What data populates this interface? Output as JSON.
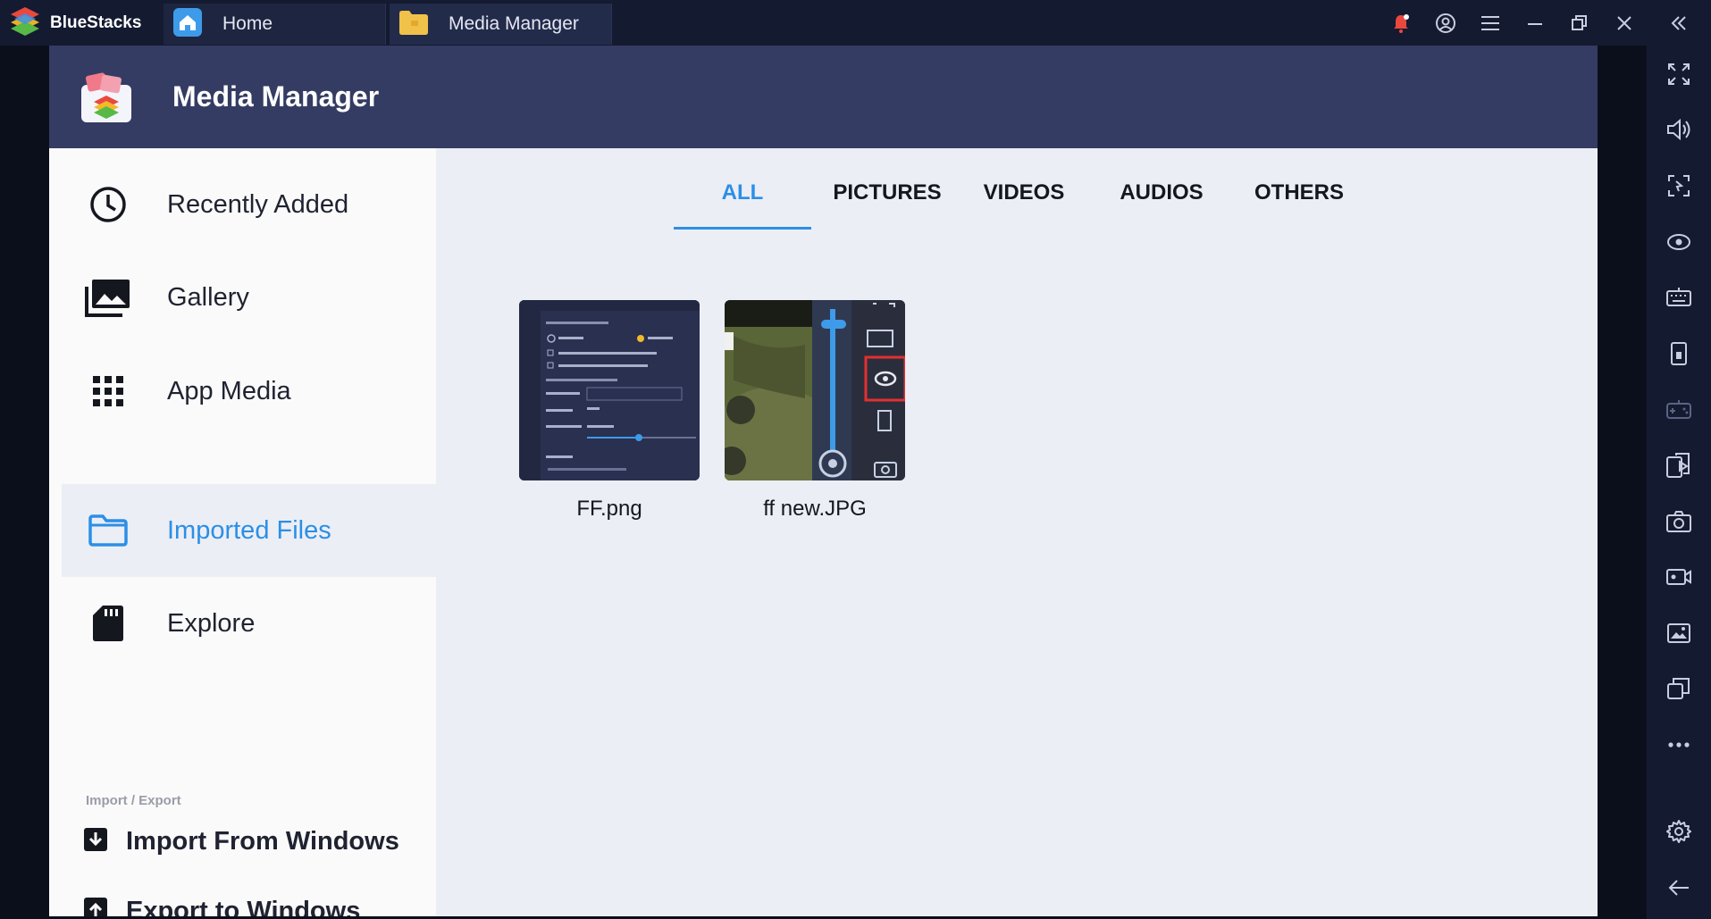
{
  "titlebar": {
    "brand": "BlueStacks",
    "tabs": [
      {
        "label": "Home",
        "icon": "home-icon"
      },
      {
        "label": "Media Manager",
        "icon": "folder-icon"
      }
    ],
    "icons": [
      "notification-bell-icon",
      "account-icon",
      "menu-icon",
      "minimize-icon",
      "restore-icon",
      "close-icon",
      "collapse-sidebar-icon"
    ]
  },
  "app": {
    "title": "Media Manager",
    "accent_color": "#2b8fe6",
    "header_color": "#343c63"
  },
  "sidebar": {
    "items": [
      {
        "label": "Recently Added",
        "icon": "clock-icon",
        "active": false
      },
      {
        "label": "Gallery",
        "icon": "gallery-icon",
        "active": false
      },
      {
        "label": "App Media",
        "icon": "grid-icon",
        "active": false
      },
      {
        "label": "Imported Files",
        "icon": "folder-icon",
        "active": true
      },
      {
        "label": "Explore",
        "icon": "sd-card-icon",
        "active": false
      }
    ],
    "section_label": "Import / Export",
    "import_label": "Import From Windows",
    "export_label": "Export to Windows"
  },
  "content": {
    "tabs": [
      {
        "label": "ALL",
        "active": true
      },
      {
        "label": "PICTURES",
        "active": false
      },
      {
        "label": "VIDEOS",
        "active": false
      },
      {
        "label": "AUDIOS",
        "active": false
      },
      {
        "label": "OTHERS",
        "active": false
      }
    ],
    "files": [
      {
        "name": "FF.png"
      },
      {
        "name": "ff new.JPG"
      }
    ]
  },
  "right_toolbar": {
    "icons": [
      "fullscreen-icon",
      "volume-icon",
      "screen-capture-icon",
      "eye-icon",
      "keyboard-icon",
      "portrait-icon",
      "gamepad-icon",
      "install-apk-icon",
      "camera-icon",
      "record-video-icon",
      "media-manager-icon",
      "multi-instance-icon",
      "more-icon",
      "settings-icon",
      "back-icon"
    ]
  }
}
